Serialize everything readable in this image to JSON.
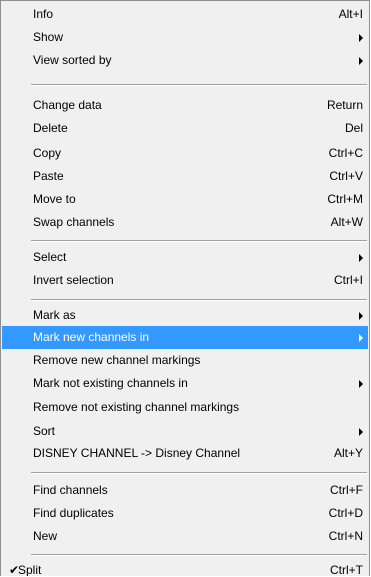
{
  "menu": {
    "groups": [
      {
        "items": [
          {
            "label": "Info",
            "accel": "Alt+I",
            "submenu": false
          },
          {
            "label": "Show",
            "accel": "",
            "submenu": true
          },
          {
            "label": "View sorted by",
            "accel": "",
            "submenu": true
          }
        ]
      },
      {
        "items": [
          {
            "label": "Change data",
            "accel": "Return",
            "submenu": false
          },
          {
            "label": "Delete",
            "accel": "Del",
            "submenu": false
          },
          {
            "label": "Copy",
            "accel": "Ctrl+C",
            "submenu": false
          },
          {
            "label": "Paste",
            "accel": "Ctrl+V",
            "submenu": false
          },
          {
            "label": "Move to",
            "accel": "Ctrl+M",
            "submenu": false
          },
          {
            "label": "Swap channels",
            "accel": "Alt+W",
            "submenu": false
          }
        ]
      },
      {
        "items": [
          {
            "label": "Select",
            "accel": "",
            "submenu": true
          },
          {
            "label": "Invert selection",
            "accel": "Ctrl+I",
            "submenu": false
          }
        ]
      },
      {
        "items": [
          {
            "label": "Mark as",
            "accel": "",
            "submenu": true
          },
          {
            "label": "Mark new channels in",
            "accel": "",
            "submenu": true,
            "highlighted": true
          },
          {
            "label": "Remove new channel markings",
            "accel": "",
            "submenu": false
          },
          {
            "label": "Mark not existing channels in",
            "accel": "",
            "submenu": true
          },
          {
            "label": "Remove not existing channel markings",
            "accel": "",
            "submenu": false
          },
          {
            "label": "Sort",
            "accel": "",
            "submenu": true
          },
          {
            "label": "DISNEY CHANNEL -> Disney Channel",
            "accel": "Alt+Y",
            "submenu": false
          }
        ]
      },
      {
        "items": [
          {
            "label": "Find channels",
            "accel": "Ctrl+F",
            "submenu": false
          },
          {
            "label": "Find duplicates",
            "accel": "Ctrl+D",
            "submenu": false
          },
          {
            "label": "New",
            "accel": "Ctrl+N",
            "submenu": false
          }
        ]
      },
      {
        "items": [
          {
            "label": "Split",
            "accel": "Ctrl+T",
            "submenu": false,
            "checked": true,
            "check_glyph": "✔"
          }
        ]
      }
    ],
    "colors": {
      "background": "#f0f0f0",
      "highlight": "#3399ff",
      "highlight_text": "#ffffff",
      "separator": "#a0a0a0"
    }
  }
}
